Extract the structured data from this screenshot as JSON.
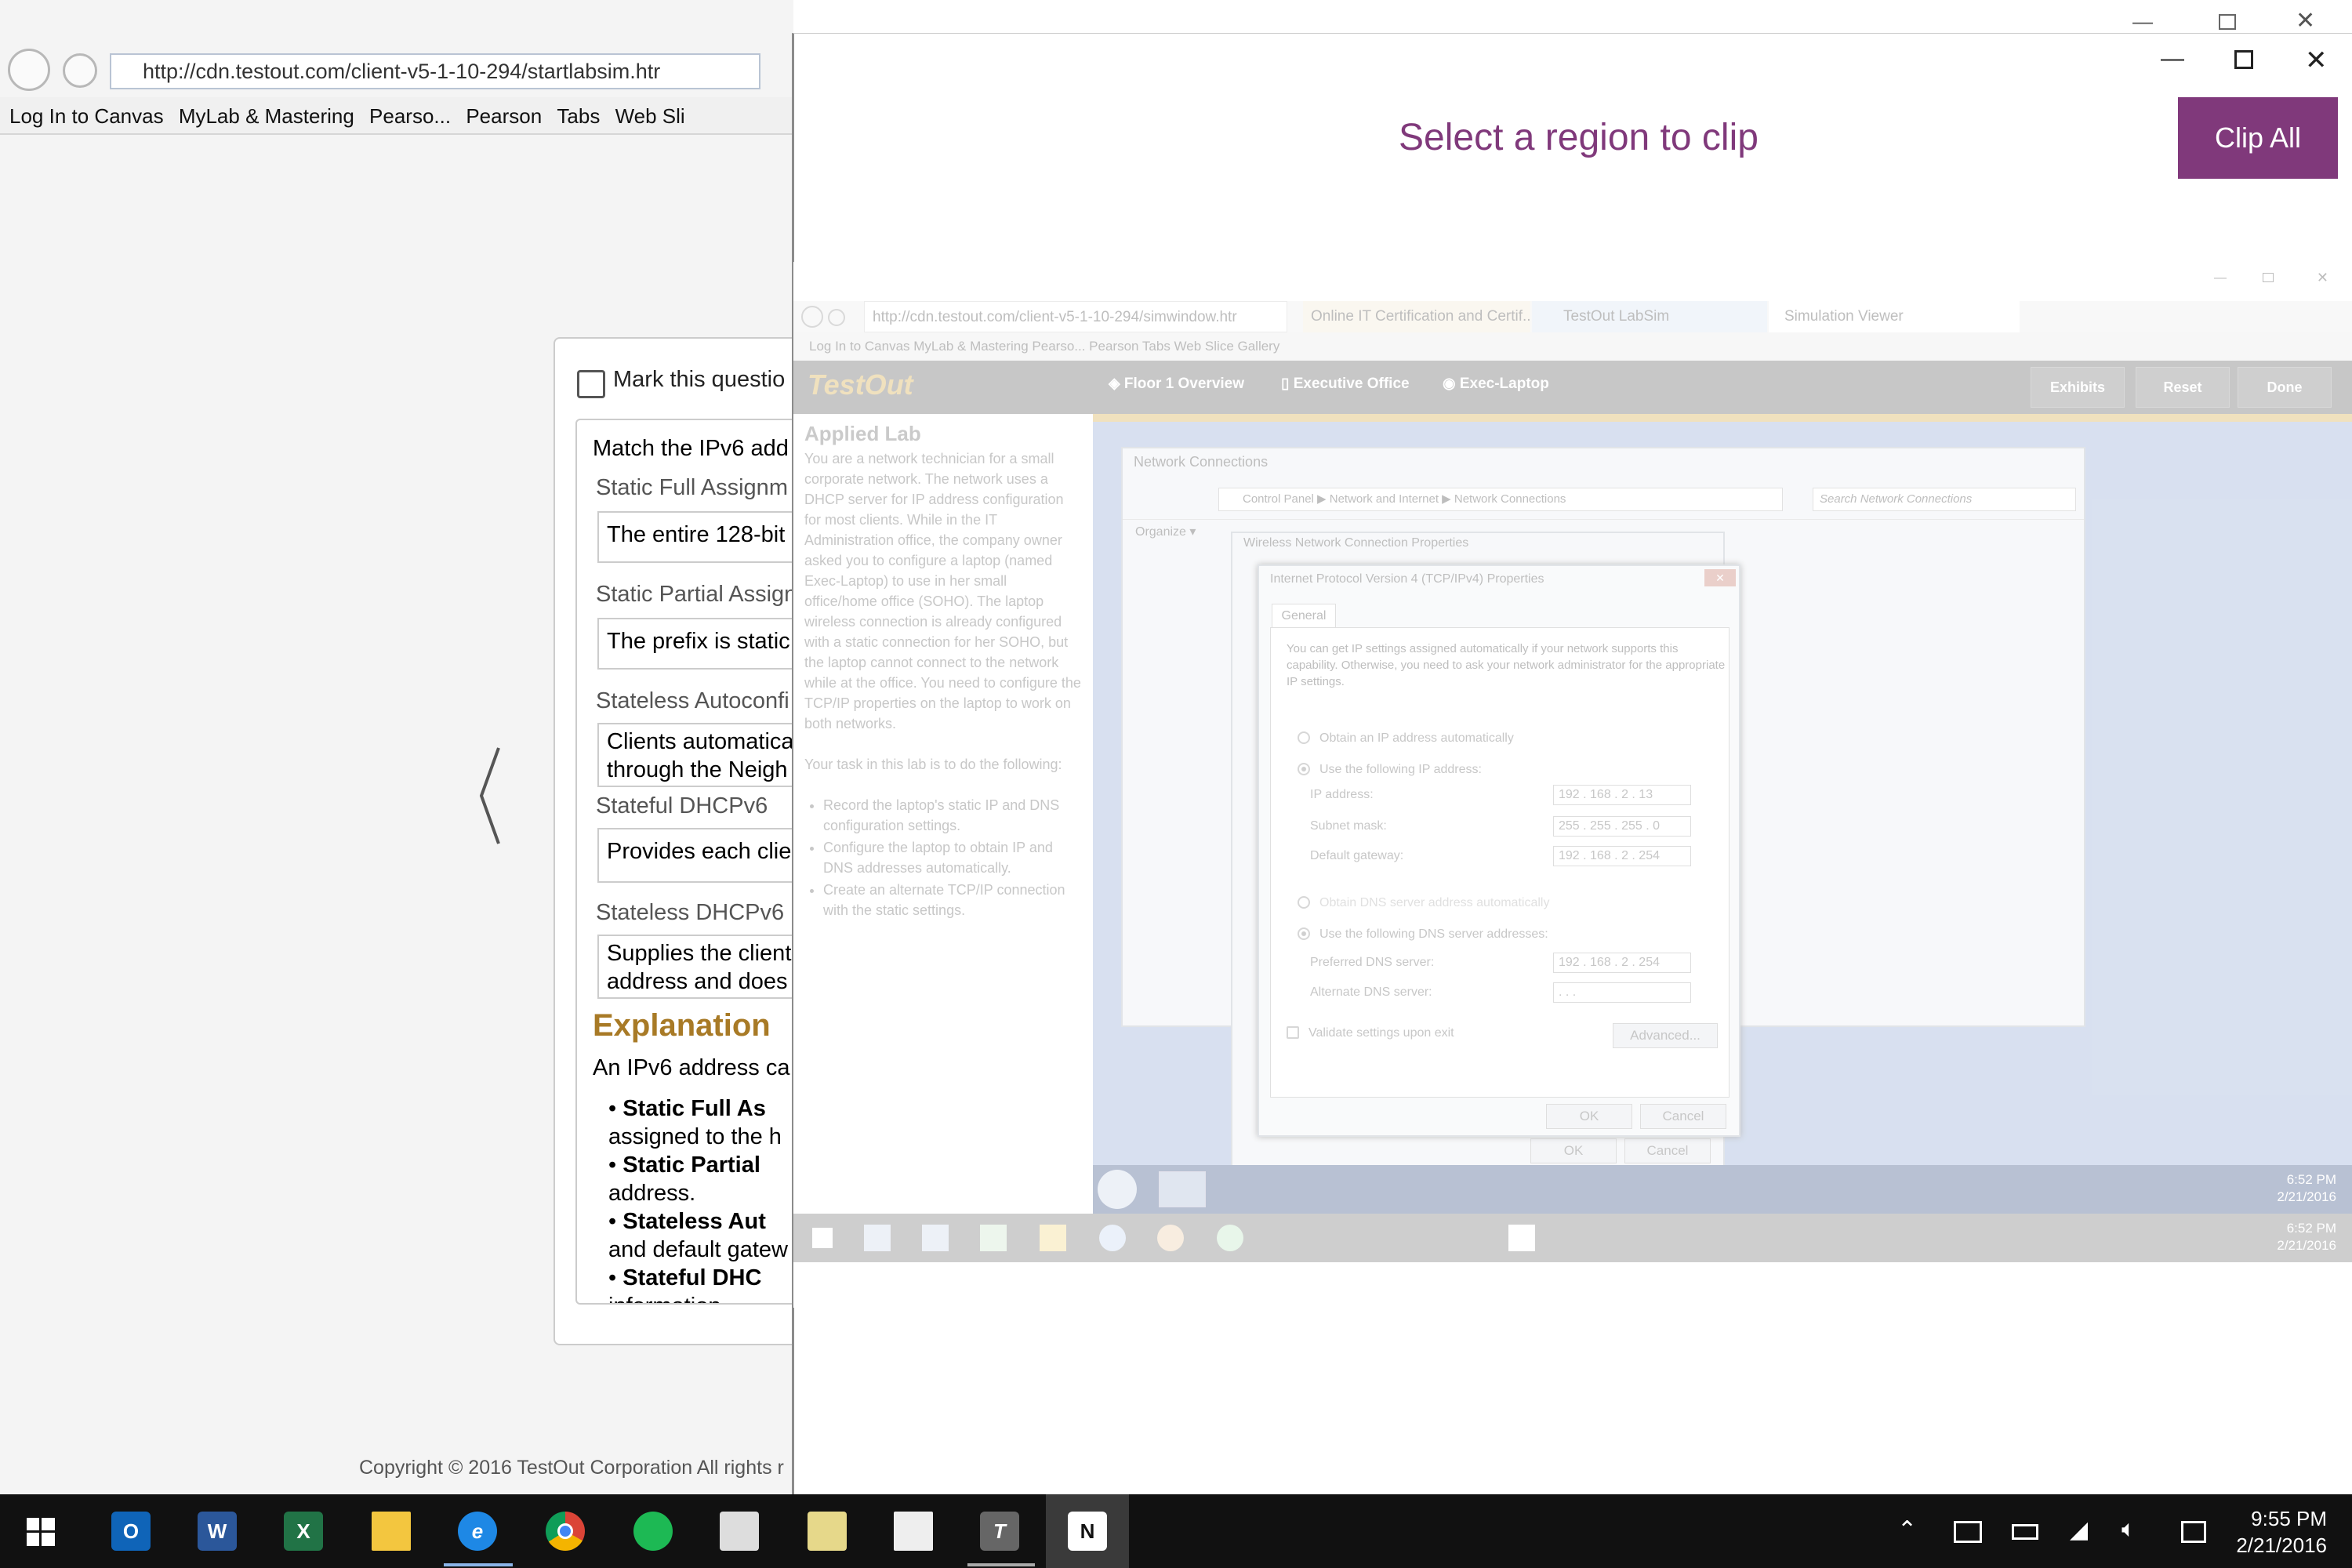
{
  "bg_browser": {
    "address": "http://cdn.testout.com/client-v5-1-10-294/startlabsim.htr",
    "favorites": [
      "Log In to Canvas",
      "MyLab & Mastering",
      "Pearso...",
      "Pearson",
      "Tabs",
      "Web Sli"
    ],
    "mark_question": "Mark this questio",
    "question_start": "Match the IPv6 add",
    "items": [
      {
        "label": "Static Full Assignm",
        "answer": "The entire 128-bit"
      },
      {
        "label": "Static Partial Assign",
        "answer": "The prefix is static"
      },
      {
        "label": "Stateless Autoconfi",
        "answer": "Clients automatica",
        "answer2": "through the Neigh"
      },
      {
        "label": "Stateful DHCPv6",
        "answer": "Provides each clier"
      },
      {
        "label": "Stateless DHCPv6",
        "answer": "Supplies the client",
        "answer2": "address and does"
      }
    ],
    "explanation_heading": "Explanation",
    "explanation_text": "An IPv6 address ca",
    "bullets": [
      {
        "bold": "Static Full As",
        "rest": "assigned to the h"
      },
      {
        "bold": "Static Partial",
        "rest": "address."
      },
      {
        "bold": "Stateless Aut",
        "rest": "and default gatew"
      },
      {
        "bold": "Stateful DHC",
        "rest": "information"
      }
    ],
    "copyright": "Copyright © 2016  TestOut Corporation  All rights r"
  },
  "clip": {
    "title": "Select a region to clip",
    "clip_all": "Clip All"
  },
  "shot": {
    "address": "http://cdn.testout.com/client-v5-1-10-294/simwindow.htr",
    "tabs": [
      "Online IT Certification and Certif...",
      "TestOut LabSim",
      "Simulation Viewer"
    ],
    "favorites": "Log In to Canvas   MyLab & Mastering  Pearso...   Pearson   Tabs   Web Slice Gallery",
    "logo": "TestOut",
    "nav": [
      "Floor 1 Overview",
      "Executive Office",
      "Exec-Laptop"
    ],
    "buttons": [
      "Exhibits",
      "Reset",
      "Done"
    ],
    "lab_title": "Applied Lab",
    "lab_text": "You are a network technician for a small corporate network. The network uses a DHCP server for IP address configuration for most clients. While in the IT Administration office, the company owner asked you to configure a laptop (named Exec-Laptop) to use in her small office/home office (SOHO). The laptop wireless connection is already configured with a static connection for her SOHO, but the laptop cannot connect to the network while at the office. You need to configure the TCP/IP properties on the laptop to work on both networks.",
    "lab_task": "Your task in this lab is to do the following:",
    "lab_items": [
      "Record the laptop's static IP and DNS configuration settings.",
      "Configure the laptop to obtain IP and DNS addresses automatically.",
      "Create an alternate TCP/IP connection with the static settings."
    ],
    "nc_title": "Network Connections",
    "nc_path": "Control Panel ▶ Network and Internet ▶ Network Connections",
    "nc_search": "Search Network Connections",
    "nc_organize": "Organize ▾",
    "wl_title": "Wireless Network Connection Properties",
    "ipv4_title": "Internet Protocol Version 4 (TCP/IPv4) Properties",
    "tab_general": "General",
    "intro": "You can get IP settings assigned automatically if your network supports this capability. Otherwise, you need to ask your network administrator for the appropriate IP settings.",
    "opt_auto_ip": "Obtain an IP address automatically",
    "opt_static_ip": "Use the following IP address:",
    "ip_label": "IP address:",
    "ip_value": "192 . 168 .  2  .  13",
    "mask_label": "Subnet mask:",
    "mask_value": "255 . 255 . 255 .  0",
    "gw_label": "Default gateway:",
    "gw_value": "192 . 168 .  2  . 254",
    "opt_auto_dns": "Obtain DNS server address automatically",
    "opt_static_dns": "Use the following DNS server addresses:",
    "pdns_label": "Preferred DNS server:",
    "pdns_value": "192 . 168 .  2  . 254",
    "adns_label": "Alternate DNS server:",
    "adns_value": "  .     .     .  ",
    "validate": "Validate settings upon exit",
    "advanced": "Advanced...",
    "ok": "OK",
    "cancel": "Cancel",
    "inner_time": "6:52 PM",
    "inner_date": "2/21/2016",
    "tb_time": "6:52 PM",
    "tb_date": "2/21/2016"
  },
  "taskbar": {
    "time": "9:55 PM",
    "date": "2/21/2016"
  }
}
